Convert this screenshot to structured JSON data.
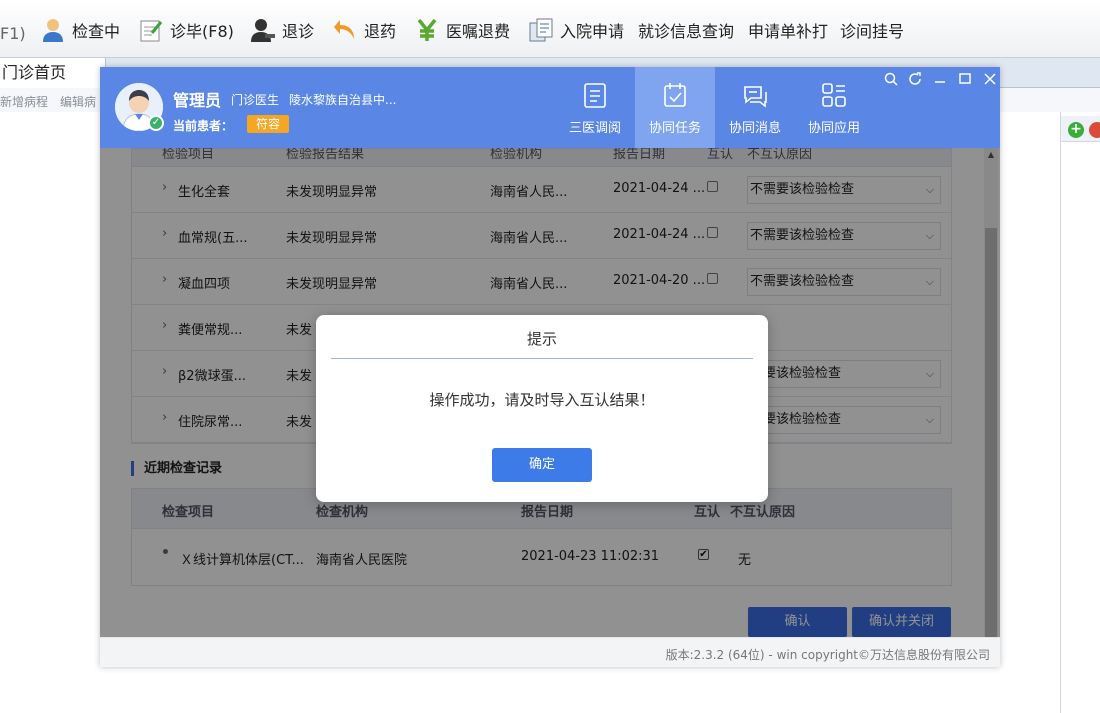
{
  "host": {
    "toolbar": {
      "first_label": "F1)",
      "items": [
        {
          "label": "检查中",
          "icon": "person-icon"
        },
        {
          "label": "诊毕(F8)",
          "icon": "notepad-icon"
        },
        {
          "label": "退诊",
          "icon": "person-remove-icon"
        },
        {
          "label": "退药",
          "icon": "return-arrow-icon"
        },
        {
          "label": "医嘱退费",
          "icon": "yen-icon"
        },
        {
          "label": "入院申请",
          "icon": "document-icon"
        },
        {
          "label": "就诊信息查询",
          "icon": ""
        },
        {
          "label": "申请单补打",
          "icon": ""
        },
        {
          "label": "诊间挂号",
          "icon": ""
        }
      ]
    },
    "home_tab": "门诊首页",
    "sub_links": [
      "新增病程",
      "编辑病"
    ]
  },
  "window": {
    "user": {
      "name": "管理员",
      "role": "门诊医生",
      "org": "陵水黎族自治县中...",
      "patient_label": "当前患者：",
      "patient_name": "符容"
    },
    "nav": [
      {
        "label": "三医调阅",
        "icon": "clipboard-icon",
        "active": false
      },
      {
        "label": "协同任务",
        "icon": "calendar-check-icon",
        "active": true
      },
      {
        "label": "协同消息",
        "icon": "chat-icon",
        "active": false
      },
      {
        "label": "协同应用",
        "icon": "grid-apps-icon",
        "active": false
      }
    ],
    "controls": [
      "search-icon",
      "refresh-icon",
      "minimize-icon",
      "maximize-icon",
      "close-icon"
    ],
    "table1": {
      "headers": [
        "检验项目",
        "检验报告结果",
        "检验机构",
        "报告日期",
        "互认",
        "不互认原因"
      ],
      "rows": [
        {
          "item": "生化全套",
          "result": "未发现明显异常",
          "org": "海南省人民...",
          "date": "2021-04-24 ...",
          "checked": false,
          "reason": "不需要该检验检查"
        },
        {
          "item": "血常规(五...",
          "result": "未发现明显异常",
          "org": "海南省人民...",
          "date": "2021-04-24 ...",
          "checked": false,
          "reason": "不需要该检验检查"
        },
        {
          "item": "凝血四项",
          "result": "未发现明显异常",
          "org": "海南省人民...",
          "date": "2021-04-20 ...",
          "checked": false,
          "reason": "不需要该检验检查"
        },
        {
          "item": "粪便常规...",
          "result": "未发",
          "org": "",
          "date": "",
          "checked": false,
          "reason": ""
        },
        {
          "item": "β2微球蛋...",
          "result": "未发",
          "org": "",
          "date": "",
          "checked": false,
          "reason": "需要该检验检查"
        },
        {
          "item": "住院尿常...",
          "result": "未发",
          "org": "",
          "date": "",
          "checked": false,
          "reason": "需要该检验检查"
        }
      ]
    },
    "section2_title": "近期检查记录",
    "table2": {
      "headers": [
        "检查项目",
        "检查机构",
        "报告日期",
        "互认",
        "不互认原因"
      ],
      "rows": [
        {
          "item": "Ｘ线计算机体层(CT...",
          "org": "海南省人民医院",
          "date": "2021-04-23 11:02:31",
          "checked": true,
          "reason": "无"
        }
      ]
    },
    "buttons": {
      "confirm": "确认",
      "confirm_close": "确认并关闭"
    },
    "footer": "版本:2.3.2 (64位) - win    copyright©万达信息股份有限公司"
  },
  "dialog": {
    "title": "提示",
    "message": "操作成功，请及时导入互认结果！",
    "ok": "确定"
  },
  "colors": {
    "header_blue": "#5a86e5",
    "active_nav": "#7fa4f0",
    "primary_button": "#3d7be8",
    "patient_badge": "#f5a623"
  }
}
